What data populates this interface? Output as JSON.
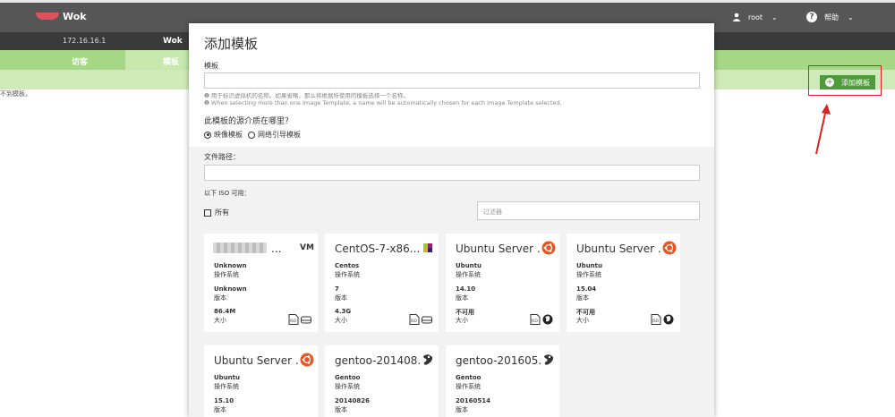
{
  "app": {
    "name": "Wok",
    "host_ip": "172.16.16.1",
    "host_name": "Wok",
    "user": "root",
    "help": "帮助",
    "tabs": [
      "访客",
      "模板"
    ],
    "empty_text": "不到模板。",
    "add_template_button": "添加模板"
  },
  "modal": {
    "title": "添加模板",
    "template_label": "模板",
    "template_value": "",
    "help_cn": "用于标识虚拟机的名称。如果省略，那么将根据所使用的模板选择一个名称。",
    "help_en": "When selecting more than one Image Template, a name will be automatically chosen for each Image Template selected.",
    "source_question": "此模板的源介质在哪里？",
    "source_options": [
      "映像模板",
      "网络引导模板"
    ],
    "selected_source": "映像模板",
    "file_path_label": "文件路径：",
    "file_path_value": "",
    "iso_available_label": "以下 ISO 可用：",
    "select_all_label": "所有",
    "filter_placeholder": "过滤器"
  },
  "iso_cards": [
    {
      "title": "...",
      "redacted": true,
      "icon": "vm-icon",
      "distro": "Unknown",
      "distro_label": "操作系统",
      "version": "Unknown",
      "version_label": "版本",
      "size": "86.4M",
      "size_label": "大小",
      "badges": [
        "iso-file-icon",
        "hard-drive-icon"
      ]
    },
    {
      "title": "CentOS-7-x86...",
      "icon": "centos-logo-icon",
      "distro": "Centos",
      "distro_label": "操作系统",
      "version": "7",
      "version_label": "版本",
      "size": "4.3G",
      "size_label": "大小",
      "badges": [
        "iso-file-icon",
        "hard-drive-icon"
      ]
    },
    {
      "title": "Ubuntu Server ...",
      "icon": "ubuntu-logo-icon",
      "distro": "Ubuntu",
      "distro_label": "操作系统",
      "version": "14.10",
      "version_label": "版本",
      "size": "不可用",
      "size_label": "大小",
      "badges": [
        "iso-file-icon",
        "globe-icon"
      ]
    },
    {
      "title": "Ubuntu Server ...",
      "icon": "ubuntu-logo-icon",
      "distro": "Ubuntu",
      "distro_label": "操作系统",
      "version": "15.04",
      "version_label": "版本",
      "size": "不可用",
      "size_label": "大小",
      "badges": [
        "iso-file-icon",
        "globe-icon"
      ]
    },
    {
      "title": "Ubuntu Server ...",
      "icon": "ubuntu-logo-icon",
      "distro": "Ubuntu",
      "distro_label": "操作系统",
      "version": "15.10",
      "version_label": "版本"
    },
    {
      "title": "gentoo-201408...",
      "icon": "gentoo-logo-icon",
      "distro": "Gentoo",
      "distro_label": "操作系统",
      "version": "20140826",
      "version_label": "版本"
    },
    {
      "title": "gentoo-201605...",
      "icon": "gentoo-logo-icon",
      "distro": "Gentoo",
      "distro_label": "操作系统",
      "version": "20160514",
      "version_label": "版本"
    }
  ],
  "colors": {
    "header": "#565656",
    "accent_green": "#a6d785",
    "button_green": "#4e9b3a",
    "highlight_red": "#e02020"
  }
}
